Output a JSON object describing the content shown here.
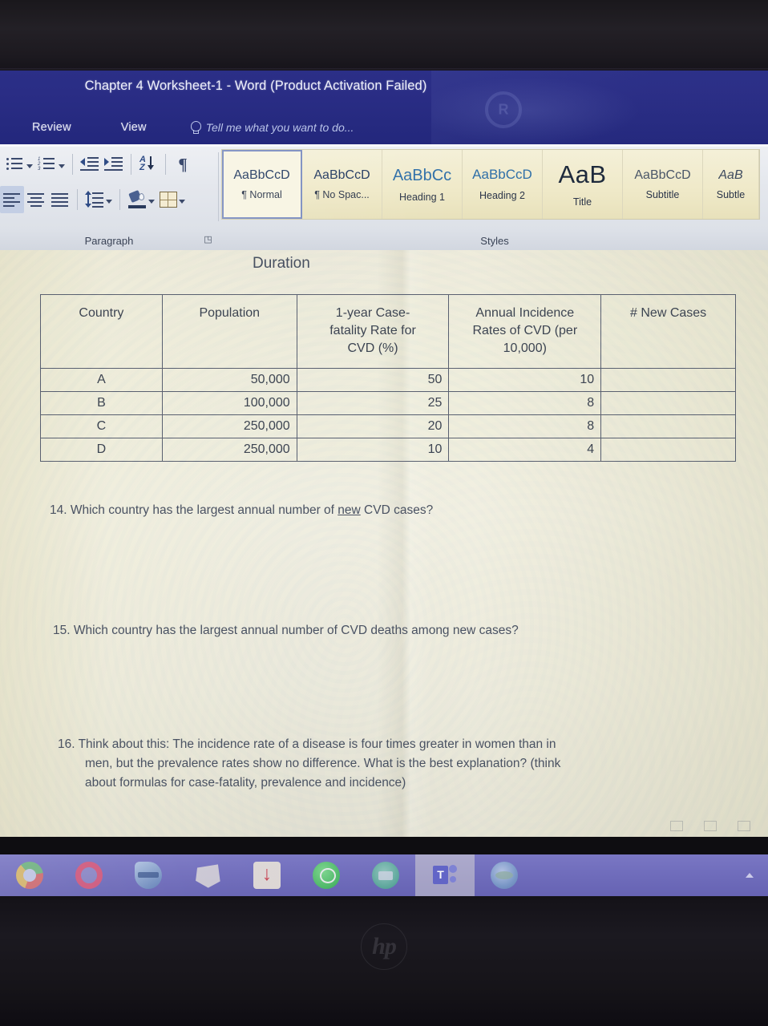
{
  "window": {
    "title": "Chapter 4 Worksheet-1 - Word (Product Activation Failed)",
    "tabs": [
      "Review",
      "View"
    ],
    "tell_me_placeholder": "Tell me what you want to do..."
  },
  "ribbon": {
    "groups": {
      "paragraph": {
        "label": "Paragraph",
        "dialog_launcher": "◳"
      },
      "styles": {
        "label": "Styles"
      }
    },
    "paragraph_icons_row1": [
      "bullets-icon",
      "bullets-dropdown-icon",
      "numbering-icon",
      "numbering-dropdown-icon",
      "decrease-indent-icon",
      "increase-indent-icon",
      "sort-icon",
      "show-formatting-marks-icon"
    ],
    "paragraph_icons_row2": [
      "align-left-icon",
      "align-center-icon",
      "align-justify-icon",
      "line-spacing-icon",
      "line-spacing-dropdown-icon",
      "shading-icon",
      "shading-dropdown-icon",
      "borders-icon",
      "borders-dropdown-icon"
    ],
    "styles_gallery": [
      {
        "preview": "AaBbCcD",
        "name": "¶ Normal",
        "variant": "normal",
        "selected": true
      },
      {
        "preview": "AaBbCcD",
        "name": "¶ No Spac...",
        "variant": "nospace",
        "selected": false
      },
      {
        "preview": "AaBbCc",
        "name": "Heading 1",
        "variant": "h1",
        "selected": false
      },
      {
        "preview": "AaBbCcD",
        "name": "Heading 2",
        "variant": "h2",
        "selected": false
      },
      {
        "preview": "AaB",
        "name": "Title",
        "variant": "title",
        "selected": false
      },
      {
        "preview": "AaBbCcD",
        "name": "Subtitle",
        "variant": "subtitle",
        "selected": false
      },
      {
        "preview": "AaB",
        "name": "Subtle",
        "variant": "subtle",
        "selected": false
      }
    ]
  },
  "document": {
    "heading": "Duration",
    "table": {
      "headers": [
        "Country",
        "Population",
        "1-year Case-fatality Rate for CVD (%)",
        "Annual Incidence Rates of CVD (per 10,000)",
        "# New Cases"
      ],
      "header_lines": [
        [
          "Country"
        ],
        [
          "Population"
        ],
        [
          "1-year Case-",
          "fatality Rate for",
          "CVD (%)"
        ],
        [
          "Annual Incidence",
          "Rates of CVD (per",
          "10,000)"
        ],
        [
          "# New Cases"
        ]
      ],
      "rows": [
        {
          "country": "A",
          "population": "50,000",
          "cfr": "50",
          "incidence": "10",
          "new_cases": ""
        },
        {
          "country": "B",
          "population": "100,000",
          "cfr": "25",
          "incidence": "8",
          "new_cases": ""
        },
        {
          "country": "C",
          "population": "250,000",
          "cfr": "20",
          "incidence": "8",
          "new_cases": ""
        },
        {
          "country": "D",
          "population": "250,000",
          "cfr": "10",
          "incidence": "4",
          "new_cases": ""
        }
      ]
    },
    "questions": {
      "q14_pre": "14. Which country has the largest annual number of ",
      "q14_underline": "new",
      "q14_post": " CVD cases?",
      "q15": "15. Which country has the largest annual number of CVD deaths among new cases?",
      "q16_line1": "16. Think about this:  The incidence rate of a disease is four times greater in women than in",
      "q16_line2": "men, but the prevalence rates show no difference.  What is the best explanation? (think",
      "q16_line3": "about formulas for case-fatality, prevalence and incidence)"
    }
  },
  "taskbar": {
    "items": [
      {
        "icon": "chrome-icon",
        "lit": false
      },
      {
        "icon": "opera-icon",
        "lit": false
      },
      {
        "icon": "blue-app-icon",
        "lit": false
      },
      {
        "icon": "white-app-icon",
        "lit": false
      },
      {
        "icon": "acrobat-icon",
        "lit": false
      },
      {
        "icon": "whatsapp-icon",
        "lit": false
      },
      {
        "icon": "green-app-icon",
        "lit": false
      },
      {
        "icon": "teams-icon",
        "lit": true
      },
      {
        "icon": "globe-icon",
        "lit": false
      }
    ],
    "tray_arrow": "show-hidden-icons-icon"
  },
  "device": {
    "logo": "hp"
  }
}
